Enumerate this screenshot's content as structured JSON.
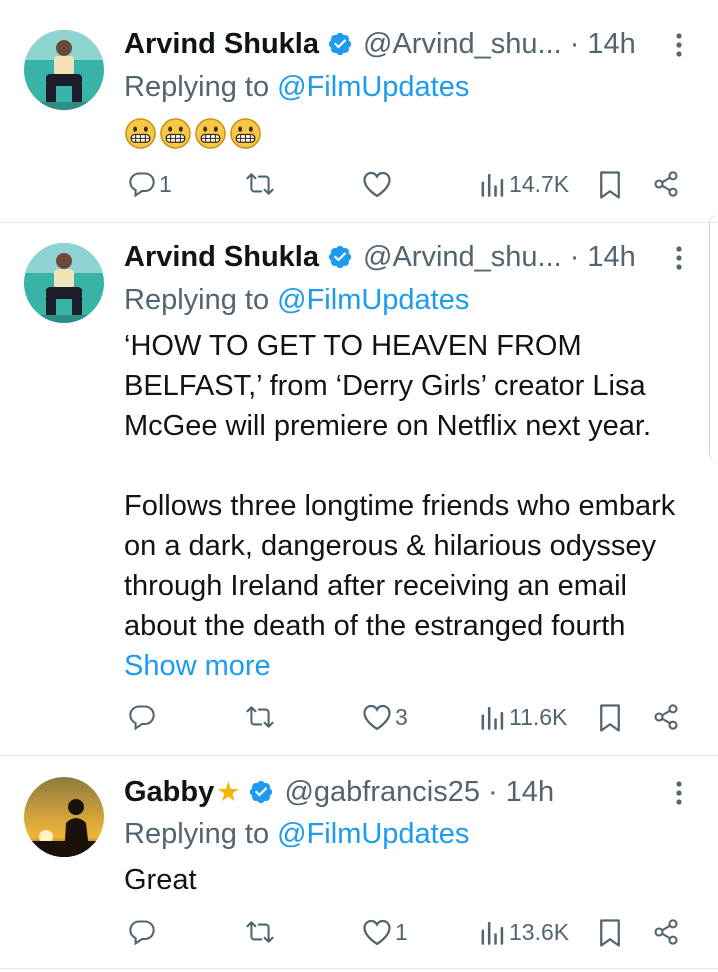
{
  "tweets": [
    {
      "name": "Arvind Shukla",
      "handle": "@Arvind_shu...",
      "time": "· 14h",
      "replying_prefix": "Replying to",
      "replying_to": "@FilmUpdates",
      "emojis": [
        "grimacing",
        "grimacing",
        "grimacing",
        "grimacing"
      ],
      "stats": {
        "replies": "1",
        "reposts": "",
        "likes": "",
        "views": "14.7K"
      }
    },
    {
      "name": "Arvind Shukla",
      "handle": "@Arvind_shu...",
      "time": "· 14h",
      "replying_prefix": "Replying to",
      "replying_to": "@FilmUpdates",
      "text_p1": "‘HOW TO GET TO HEAVEN FROM BELFAST,’ from ‘Derry Girls’ creator Lisa McGee will premiere on Netflix next year.",
      "text_p2": "Follows three longtime friends who embark on a dark, dangerous & hilarious odyssey through Ireland after receiving an email about the death of the estranged fourth",
      "show_more": "Show more",
      "stats": {
        "replies": "",
        "reposts": "",
        "likes": "3",
        "views": "11.6K"
      }
    },
    {
      "name": "Gabby",
      "name_badge": "★",
      "handle": "@gabfrancis25",
      "time": "· 14h",
      "replying_prefix": "Replying to",
      "replying_to": "@FilmUpdates",
      "text_p1": "Great",
      "stats": {
        "replies": "",
        "reposts": "",
        "likes": "1",
        "views": "13.6K"
      }
    }
  ],
  "colors": {
    "accent": "#1d9bf0",
    "muted": "#536471",
    "text": "#0f1419",
    "star": "#f5b400"
  }
}
